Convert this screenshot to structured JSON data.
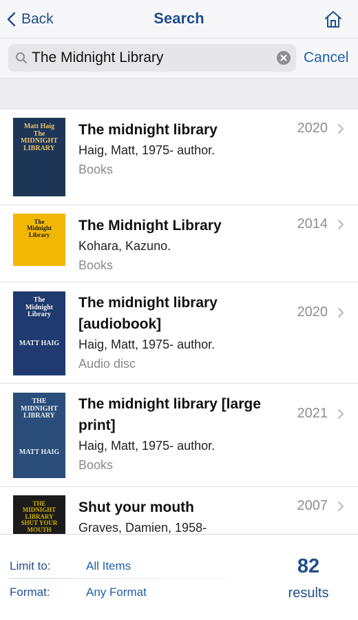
{
  "nav": {
    "back_label": "Back",
    "title": "Search",
    "home_icon": "home-icon"
  },
  "search": {
    "value": "The Midnight Library",
    "cancel_label": "Cancel"
  },
  "results": [
    {
      "title_lines": [
        "The midnight library"
      ],
      "author": "Haig, Matt, 1975- author.",
      "format": "Books",
      "year": "2020",
      "cover": {
        "bg": "#1d3557",
        "text": "Matt Haig\nThe\nMIDNIGHT\nLIBRARY",
        "color": "#e9c46a"
      }
    },
    {
      "title_lines": [
        "The Midnight Library"
      ],
      "author": "Kohara, Kazuno.",
      "format": "Books",
      "year": "2014",
      "cover": {
        "bg": "#f2b705",
        "text": "The\nMidnight\nLibrary",
        "color": "#1a1a1a"
      }
    },
    {
      "title_lines": [
        "The midnight library",
        "[audiobook]"
      ],
      "author": "Haig, Matt, 1975- author.",
      "format": "Audio disc",
      "year": "2020",
      "cover": {
        "bg": "#1e3a6e",
        "text": "The\nMidnight\nLibrary\n\n\n\nMATT HAIG",
        "color": "#f1f1f1"
      }
    },
    {
      "title_lines": [
        "The midnight library [large",
        "print]"
      ],
      "author": "Haig, Matt, 1975- author.",
      "format": "Books",
      "year": "2021",
      "cover": {
        "bg": "#2a4d7a",
        "text": "THE\nMIDNIGHT\nLIBRARY\n\n\n\n\nMATT HAIG",
        "color": "#e8eef5"
      }
    },
    {
      "title_lines": [
        "Shut your mouth"
      ],
      "author": "Graves, Damien, 1958-",
      "format": "",
      "year": "2007",
      "cover": {
        "bg": "#1b1b1b",
        "text": "THE\nMIDNIGHT\nLIBRARY\nSHUT YOUR MOUTH",
        "color": "#d4b200"
      }
    }
  ],
  "footer": {
    "limit_label": "Limit to:",
    "limit_value": "All Items",
    "format_label": "Format:",
    "format_value": "Any Format",
    "count": "82",
    "count_label": "results"
  },
  "colors": {
    "accent": "#1f4e8c",
    "link": "#1f5fa8",
    "muted": "#8e8e93"
  }
}
